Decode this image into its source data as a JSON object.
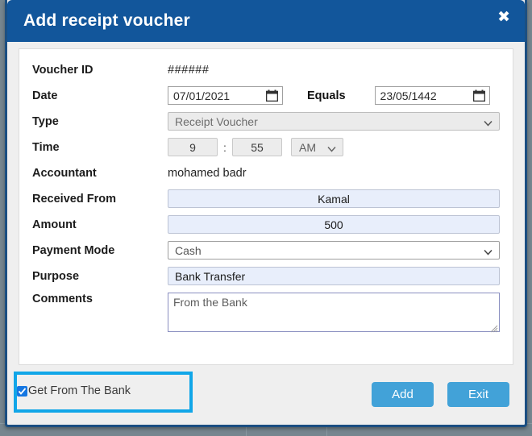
{
  "dialog": {
    "title": "Add receipt voucher",
    "close_icon": "close-icon"
  },
  "form": {
    "voucher_id": {
      "label": "Voucher ID",
      "value": "######"
    },
    "date": {
      "label": "Date",
      "value": "07/01/2021",
      "equals_label": "Equals",
      "hijri_value": "23/05/1442",
      "calendar_icon": "calendar-icon"
    },
    "type": {
      "label": "Type",
      "value": "Receipt Voucher"
    },
    "time": {
      "label": "Time",
      "hour": "9",
      "separator": ":",
      "minute": "55",
      "meridiem": "AM"
    },
    "accountant": {
      "label": "Accountant",
      "value": "mohamed badr"
    },
    "received_from": {
      "label": "Received From",
      "value": "Kamal"
    },
    "amount": {
      "label": "Amount",
      "value": "500"
    },
    "payment_mode": {
      "label": "Payment Mode",
      "value": "Cash"
    },
    "purpose": {
      "label": "Purpose",
      "value": "Bank Transfer"
    },
    "comments": {
      "label": "Comments",
      "value": "From the Bank"
    }
  },
  "footer": {
    "checkbox_label": "Get From The Bank",
    "checkbox_checked": true,
    "add_label": "Add",
    "exit_label": "Exit"
  },
  "colors": {
    "titlebar": "#12569b",
    "modal_border": "#1b4f82",
    "button_blue": "#42a2d8",
    "highlight_cyan": "#11a6e8",
    "field_lavender": "#e8eefb",
    "checkbox_blue": "#1476e2"
  }
}
